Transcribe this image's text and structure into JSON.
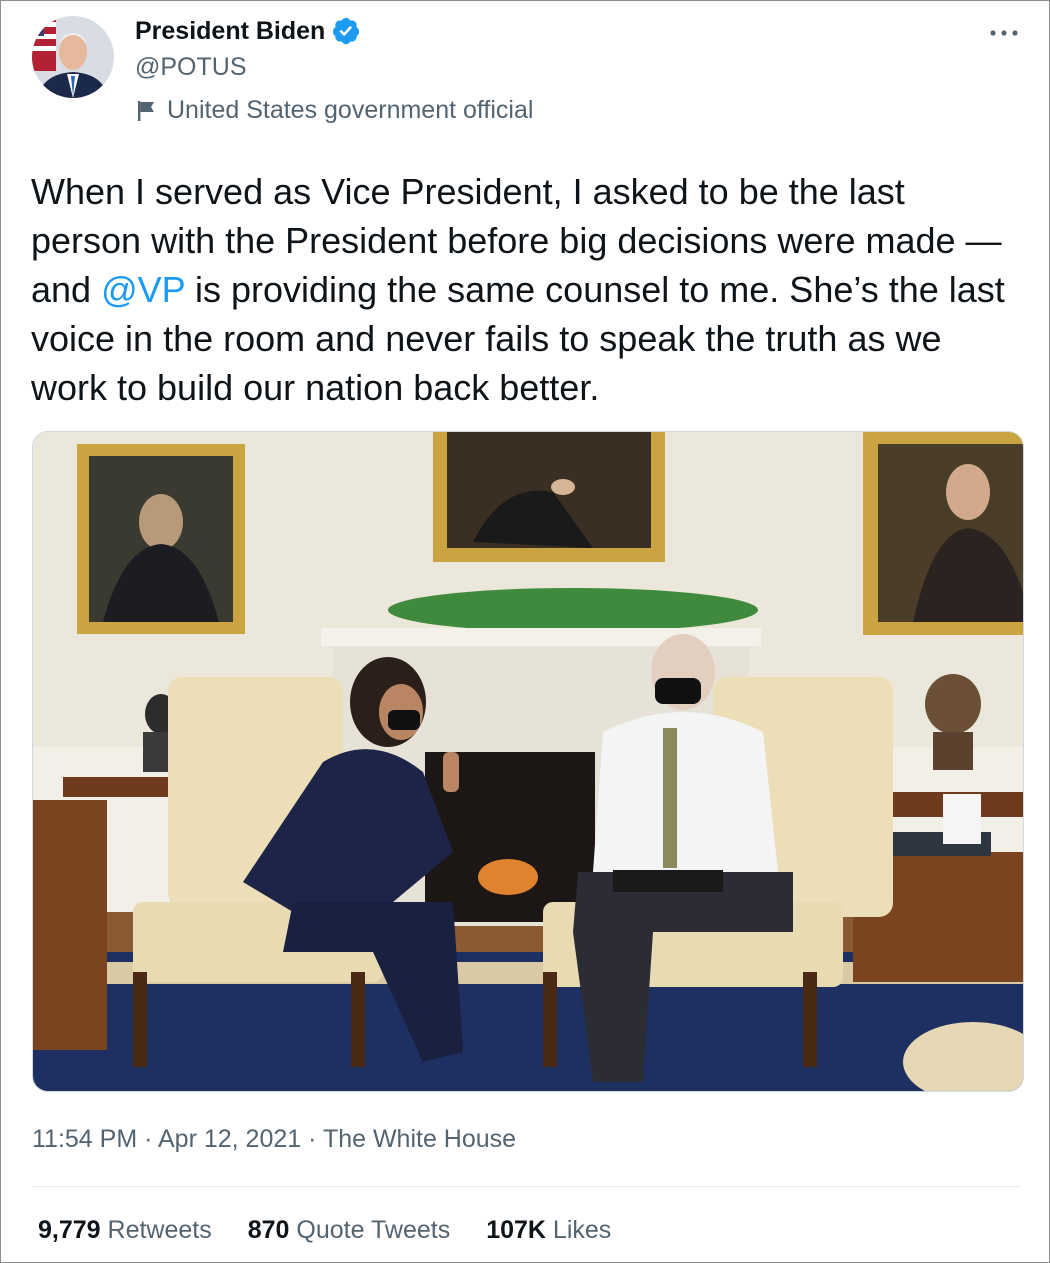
{
  "author": {
    "display_name": "President Biden",
    "handle": "@POTUS",
    "label": "United States government official",
    "verified": true
  },
  "tweet": {
    "text_before": "When I served as Vice President, I asked to be the last person with the President before big decisions were made — and ",
    "mention": "@VP",
    "text_after": " is providing the same counsel to me. She’s the last voice in the room and never fails to speak the truth as we work to build our nation back better."
  },
  "meta": {
    "time": "11:54 PM",
    "separator": " · ",
    "date": "Apr 12, 2021",
    "source": "The White House"
  },
  "stats": {
    "retweets_count": "9,779",
    "retweets_label": "Retweets",
    "quotes_count": "870",
    "quotes_label": "Quote Tweets",
    "likes_count": "107K",
    "likes_label": "Likes"
  },
  "icons": {
    "verified": "verified-badge-icon",
    "label": "flag-icon",
    "more": "more-options-icon"
  },
  "colors": {
    "accent": "#1d9bf0",
    "secondary_text": "#536471",
    "primary_text": "#0f1419"
  }
}
